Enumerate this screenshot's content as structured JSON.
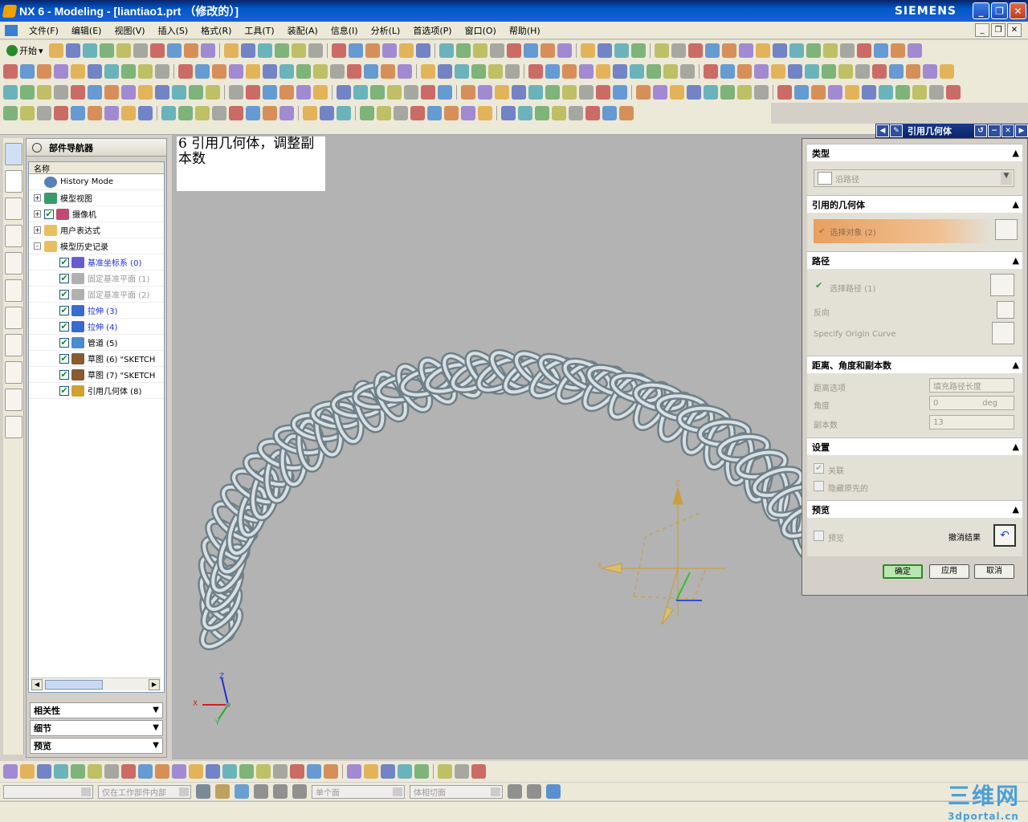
{
  "window": {
    "title": "NX 6 - Modeling - [liantiao1.prt （修改的）]",
    "brand": "SIEMENS"
  },
  "menu": [
    "文件(F)",
    "编辑(E)",
    "视图(V)",
    "插入(S)",
    "格式(R)",
    "工具(T)",
    "装配(A)",
    "信息(I)",
    "分析(L)",
    "首选项(P)",
    "窗口(O)",
    "帮助(H)"
  ],
  "toolbar": {
    "start_label": "开始"
  },
  "note": {
    "text": "6 引用几何体，调整副本数"
  },
  "nav": {
    "title": "部件导航器",
    "column_header": "名称",
    "items": [
      {
        "label": "History Mode",
        "indent": 0,
        "expand": "",
        "check": false,
        "style": "normal",
        "icon": "clock-icon"
      },
      {
        "label": "模型视图",
        "indent": 0,
        "expand": "+",
        "check": false,
        "style": "normal",
        "icon": "views-icon"
      },
      {
        "label": "摄像机",
        "indent": 0,
        "expand": "+",
        "check": true,
        "style": "normal",
        "icon": "camera-icon"
      },
      {
        "label": "用户表达式",
        "indent": 0,
        "expand": "+",
        "check": false,
        "style": "normal",
        "icon": "folder-icon"
      },
      {
        "label": "模型历史记录",
        "indent": 0,
        "expand": "-",
        "check": false,
        "style": "normal",
        "icon": "folder-icon"
      },
      {
        "label": "基准坐标系 (0)",
        "indent": 1,
        "expand": "",
        "check": true,
        "style": "blue",
        "icon": "csys-icon"
      },
      {
        "label": "固定基准平面 (1)",
        "indent": 1,
        "expand": "",
        "check": true,
        "style": "dim",
        "icon": "plane-icon"
      },
      {
        "label": "固定基准平面 (2)",
        "indent": 1,
        "expand": "",
        "check": true,
        "style": "dim",
        "icon": "plane-icon"
      },
      {
        "label": "拉伸 (3)",
        "indent": 1,
        "expand": "",
        "check": true,
        "style": "blue",
        "icon": "extrude-icon"
      },
      {
        "label": "拉伸 (4)",
        "indent": 1,
        "expand": "",
        "check": true,
        "style": "blue",
        "icon": "extrude-icon"
      },
      {
        "label": "管道 (5)",
        "indent": 1,
        "expand": "",
        "check": true,
        "style": "normal",
        "icon": "tube-icon"
      },
      {
        "label": "草图 (6) \"SKETCH",
        "indent": 1,
        "expand": "",
        "check": true,
        "style": "normal",
        "icon": "sketch-icon"
      },
      {
        "label": "草图 (7) \"SKETCH",
        "indent": 1,
        "expand": "",
        "check": true,
        "style": "normal",
        "icon": "sketch-icon"
      },
      {
        "label": "引用几何体 (8)",
        "indent": 1,
        "expand": "",
        "check": true,
        "style": "normal",
        "icon": "instance-icon"
      }
    ],
    "sections": [
      "相关性",
      "细节",
      "预览"
    ]
  },
  "dialog": {
    "title": "引用几何体",
    "type_section": "类型",
    "type_value": "沿路径",
    "ref_section": "引用的几何体",
    "select_object": "选择对象 (2)",
    "path_section": "路径",
    "select_path": "选择路径 (1)",
    "reverse": "反向",
    "origin_curve": "Specify Origin Curve",
    "dist_section": "距离、角度和副本数",
    "dist_option_label": "距离选项",
    "dist_option_value": "填充路径长度",
    "angle_label": "角度",
    "angle_value": "0",
    "angle_unit": "deg",
    "copies_label": "副本数",
    "copies_value": "13",
    "settings_section": "设置",
    "associative": "关联",
    "hide_original": "隐藏原先的",
    "preview_section": "预览",
    "preview": "预览",
    "undo_result": "撤消结果",
    "ok": "确定",
    "apply": "应用",
    "cancel": "取消"
  },
  "statusbar": {
    "filter1": "",
    "filter2": "仅在工作部件内部",
    "filter3": "单个面",
    "filter4": "体相切面"
  },
  "triad": {
    "x": "X",
    "y": "Y",
    "z": "Z"
  },
  "watermark": {
    "big": "三维网",
    "small": "3dportal.cn"
  }
}
